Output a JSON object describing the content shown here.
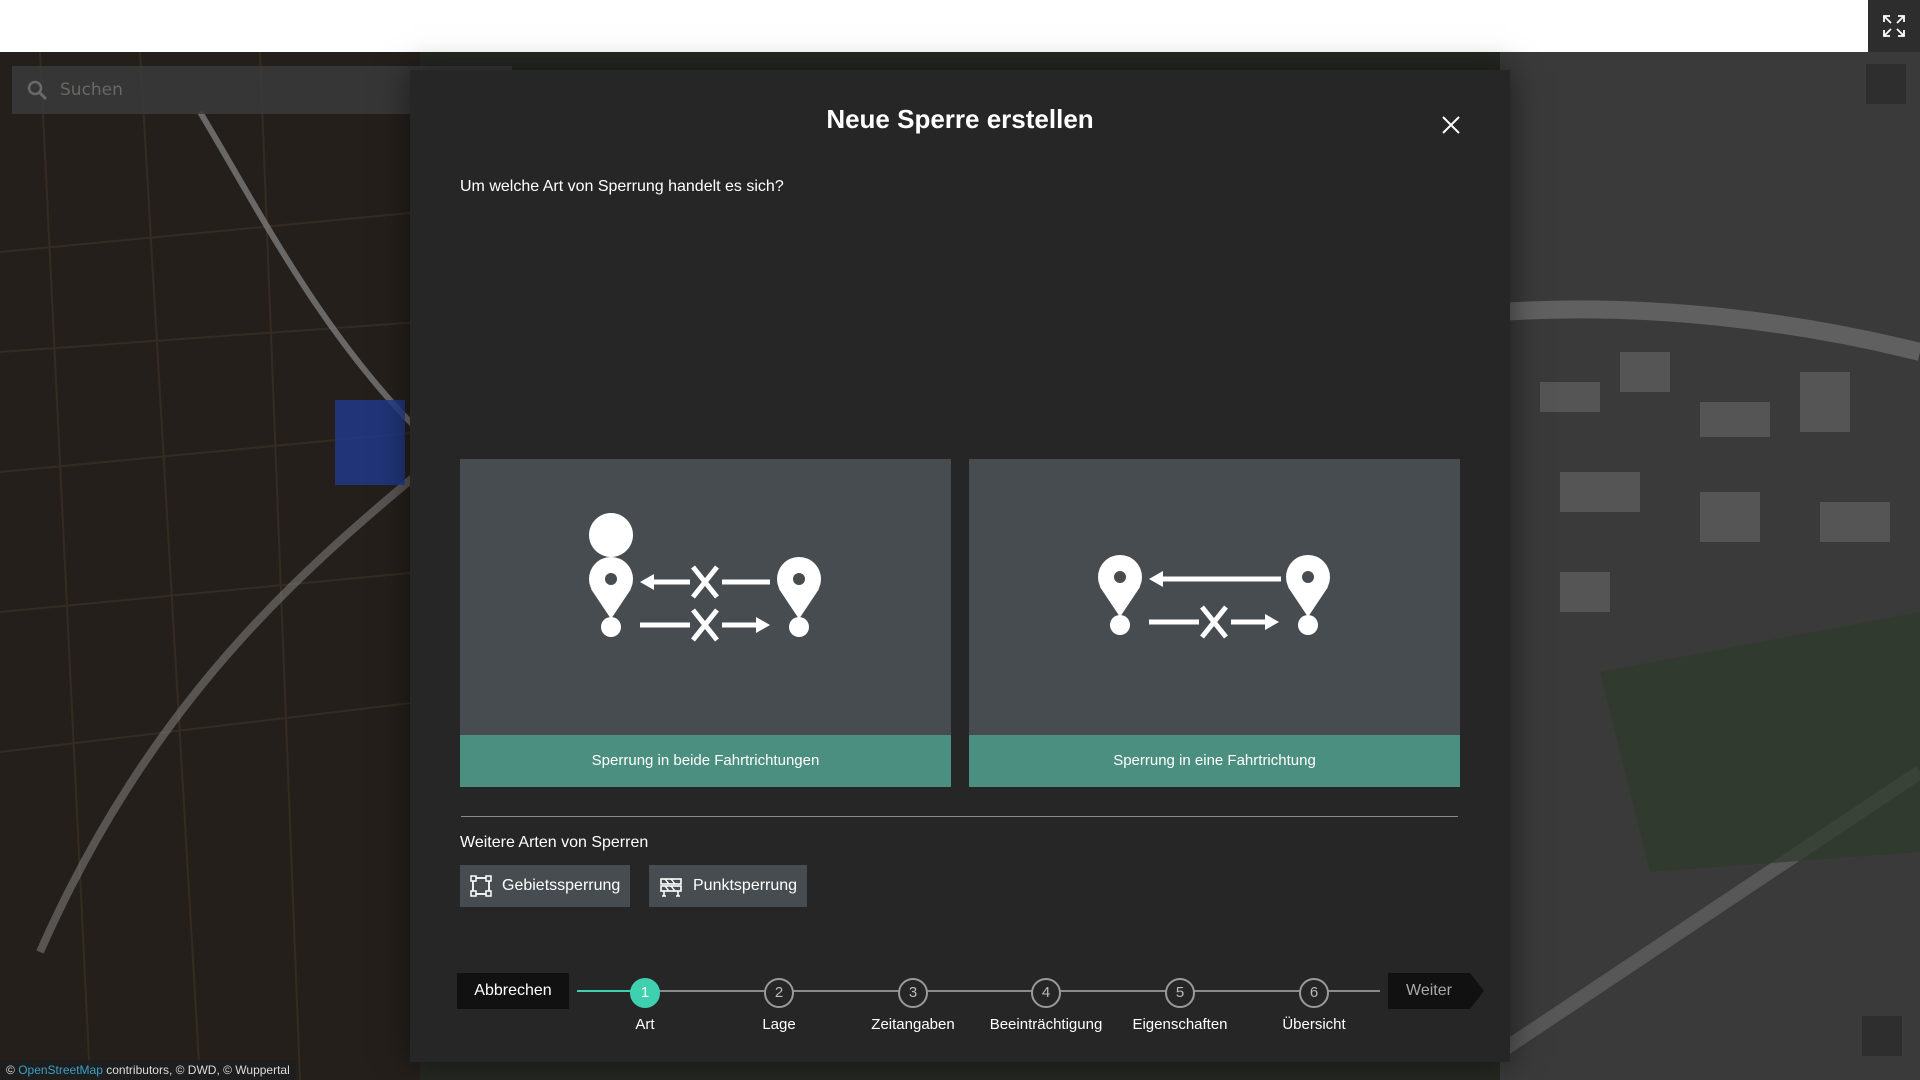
{
  "map": {
    "search_placeholder": "Suchen",
    "attribution": {
      "prefix": "©",
      "osm_link": "OpenStreetMap",
      "rest": "contributors, © DWD, © Wuppertal"
    }
  },
  "dialog": {
    "title": "Neue Sperre erstellen",
    "question": "Um welche Art von Sperrung handelt es sich?",
    "cards": [
      {
        "label": "Sperrung in beide Fahrtrichtungen"
      },
      {
        "label": "Sperrung in eine Fahrtrichtung"
      }
    ],
    "more_title": "Weitere Arten von Sperren",
    "more_buttons": [
      {
        "label": "Gebietssperrung",
        "icon": "area-icon"
      },
      {
        "label": "Punktsperrung",
        "icon": "barrier-icon"
      }
    ]
  },
  "wizard": {
    "cancel_label": "Abbrechen",
    "next_label": "Weiter",
    "active_step": 1,
    "steps": [
      {
        "number": "1",
        "label": "Art"
      },
      {
        "number": "2",
        "label": "Lage"
      },
      {
        "number": "3",
        "label": "Zeitangaben"
      },
      {
        "number": "4",
        "label": "Beeinträchtigung"
      },
      {
        "number": "5",
        "label": "Eigenschaften"
      },
      {
        "number": "6",
        "label": "Übersicht"
      }
    ]
  },
  "colors": {
    "accent": "#3fd0b0",
    "card_label_bg": "#4a8f7f",
    "card_bg": "#474c50",
    "dialog_bg": "#262626"
  }
}
